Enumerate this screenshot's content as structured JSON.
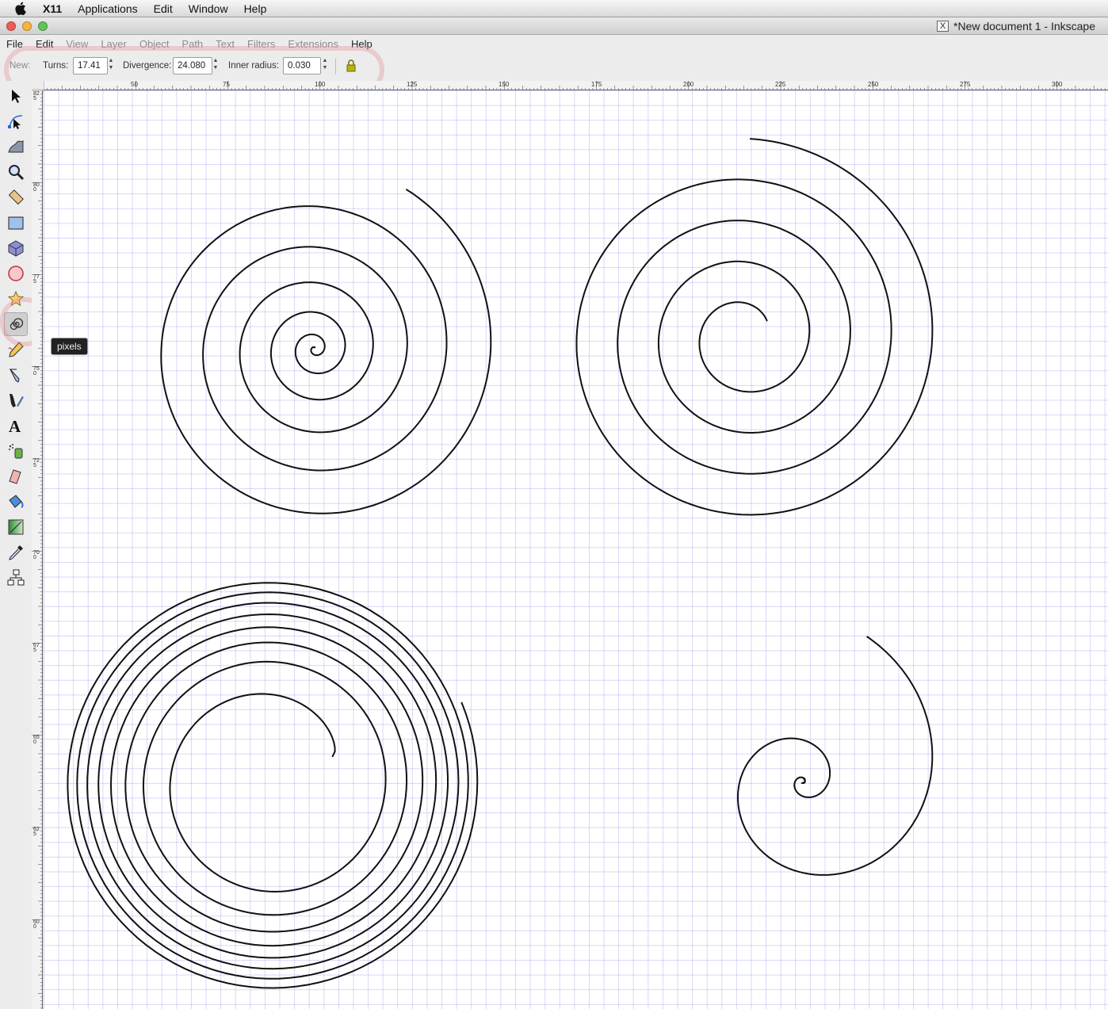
{
  "mac_menubar": {
    "apple_icon": "apple-logo-icon",
    "items": [
      "X11",
      "Applications",
      "Edit",
      "Window",
      "Help"
    ]
  },
  "window": {
    "title": "*New document 1 - Inkscape",
    "close_color": "#ee5c55",
    "minimize_color": "#f5b63f",
    "zoom_color": "#61c454"
  },
  "app_menu": {
    "items": [
      {
        "label": "File",
        "enabled": true
      },
      {
        "label": "Edit",
        "enabled": true
      },
      {
        "label": "View",
        "enabled": false
      },
      {
        "label": "Layer",
        "enabled": false
      },
      {
        "label": "Object",
        "enabled": false
      },
      {
        "label": "Path",
        "enabled": false
      },
      {
        "label": "Text",
        "enabled": false
      },
      {
        "label": "Filters",
        "enabled": false
      },
      {
        "label": "Extensions",
        "enabled": false
      },
      {
        "label": "Help",
        "enabled": true
      }
    ]
  },
  "controls": {
    "new_label": "New:",
    "turns_label": "Turns:",
    "turns_value": "17.41",
    "divergence_label": "Divergence:",
    "divergence_value": "24.080",
    "inner_radius_label": "Inner radius:",
    "inner_radius_value": "0.030",
    "reset_icon": "reset-defaults-icon"
  },
  "hruler": {
    "labels": [
      "50",
      "75",
      "100",
      "125",
      "150",
      "175",
      "200",
      "225",
      "250",
      "275",
      "300"
    ]
  },
  "vruler": {
    "labels": [
      "825",
      "800",
      "775",
      "750",
      "725",
      "700",
      "675",
      "650",
      "625",
      "600"
    ]
  },
  "toolbox": {
    "tools": [
      "selector-tool-icon",
      "node-tool-icon",
      "tweak-tool-icon",
      "zoom-tool-icon",
      "measure-tool-icon",
      "rectangle-tool-icon",
      "3d-box-tool-icon",
      "ellipse-tool-icon",
      "star-tool-icon",
      "spiral-tool-icon",
      "pencil-tool-icon",
      "pen-tool-icon",
      "calligraphy-tool-icon",
      "text-tool-icon",
      "spray-tool-icon",
      "eraser-tool-icon",
      "paint-bucket-tool-icon",
      "gradient-tool-icon",
      "dropper-tool-icon",
      "connector-tool-icon"
    ],
    "active_tool": "spiral-tool-icon"
  },
  "tooltip": {
    "text": "pixels"
  },
  "highlight_color": "#e68c96"
}
